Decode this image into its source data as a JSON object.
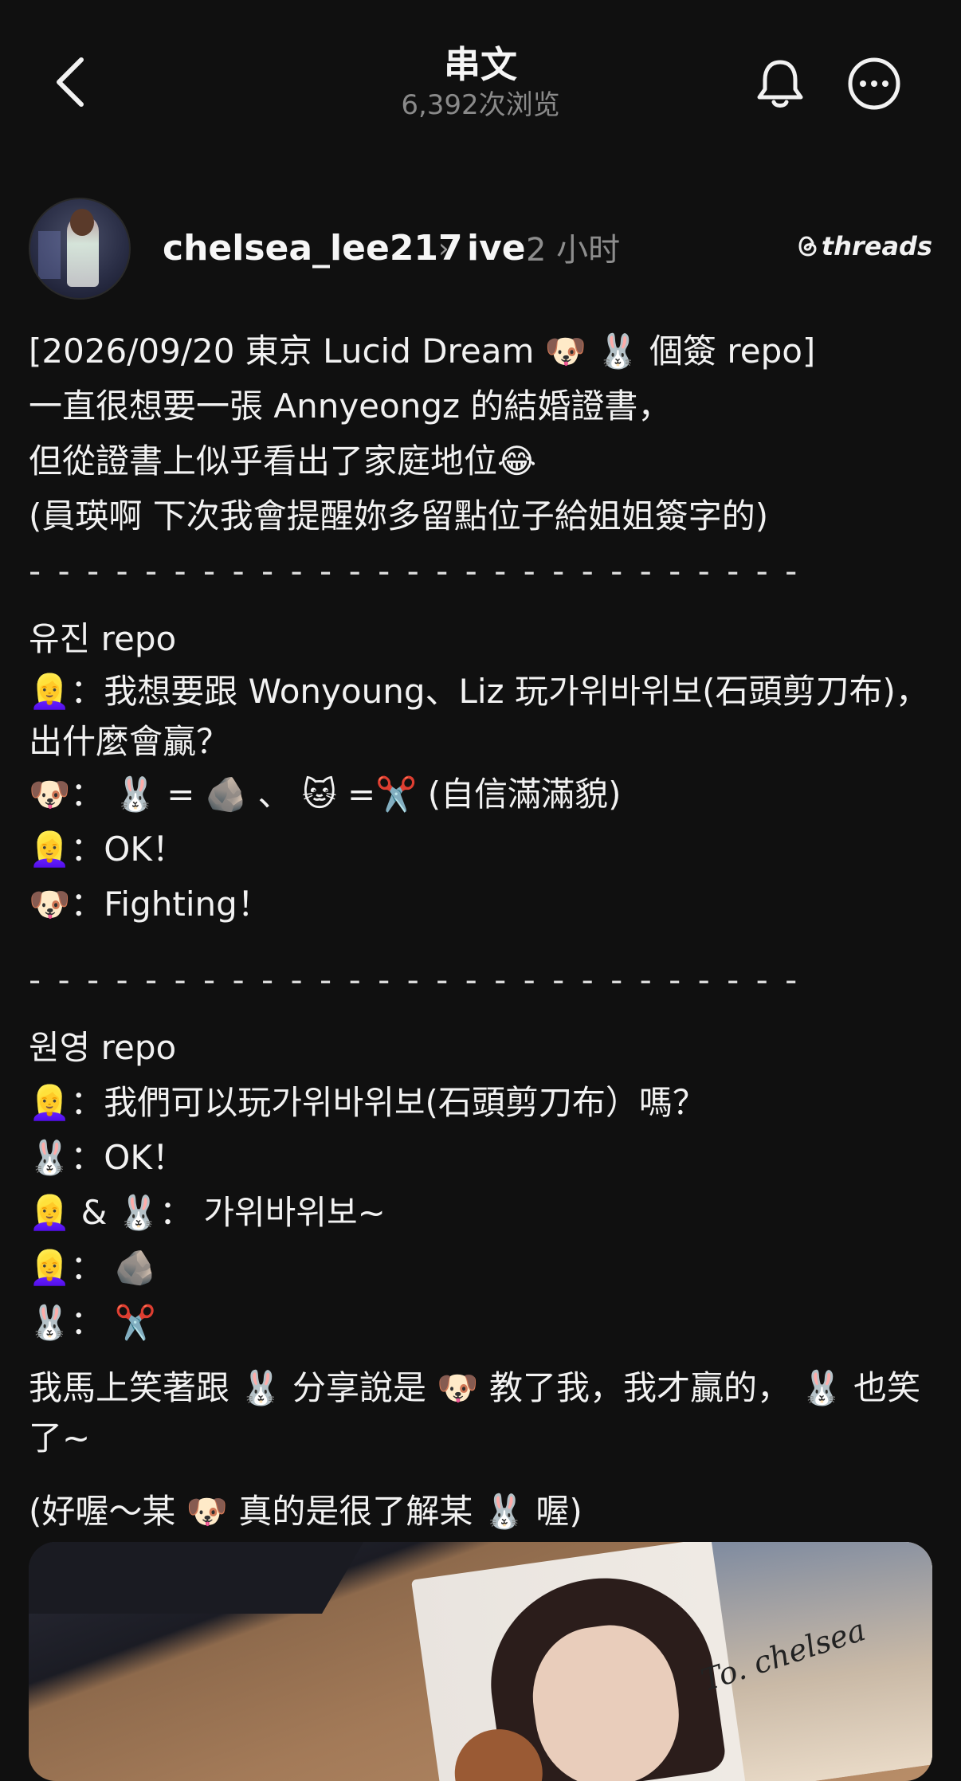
{
  "header": {
    "title": "串文",
    "views": "6,392次浏览"
  },
  "author": {
    "username": "chelsea_lee217",
    "community": "ive",
    "time": "2 小时",
    "badge_text": "threads"
  },
  "post": {
    "lines": [
      "[2026/09/20 東京 Lucid Dream 🐶 🐰 個簽 repo]",
      "一直很想要一張 Annyeongz 的結婚證書，",
      "但從證書上似乎看出了家庭地位😂",
      "(員瑛啊 下次我會提醒妳多留點位子給姐姐簽字的)",
      "- - - - - - - - - - - - - - - - - - - - - - - - - - -",
      "유진 repo",
      "👱‍♀️：我想要跟 Wonyoung、Liz 玩가위바위보(石頭剪刀布)，出什麼會贏？",
      "🐶： 🐰 = 🪨 、 🐱 =✂️ (自信滿滿貌)",
      "👱‍♀️：OK！",
      "🐶：Fighting！",
      "- - - - - - - - - - - - - - - - - - - - - - - - - - -",
      "원영 repo",
      "👱‍♀️：我們可以玩가위바위보(石頭剪刀布）嗎？",
      "🐰：OK！",
      "👱‍♀️ & 🐰： 가위바위보~",
      "👱‍♀️： 🪨",
      "🐰： ✂️",
      "我馬上笑著跟 🐰 分享說是 🐶 教了我，我才贏的， 🐰 也笑了~",
      "(好喔～某 🐶 真的是很了解某 🐰 喔)"
    ]
  },
  "photo": {
    "signature": "To. chelsea"
  },
  "colors": {
    "background": "#101010",
    "text": "#f2f2f2",
    "muted": "#8d8d8d"
  },
  "icons": [
    "back-chevron-icon",
    "bell-icon",
    "more-icon",
    "threads-logo-icon",
    "chevron-right-icon"
  ]
}
